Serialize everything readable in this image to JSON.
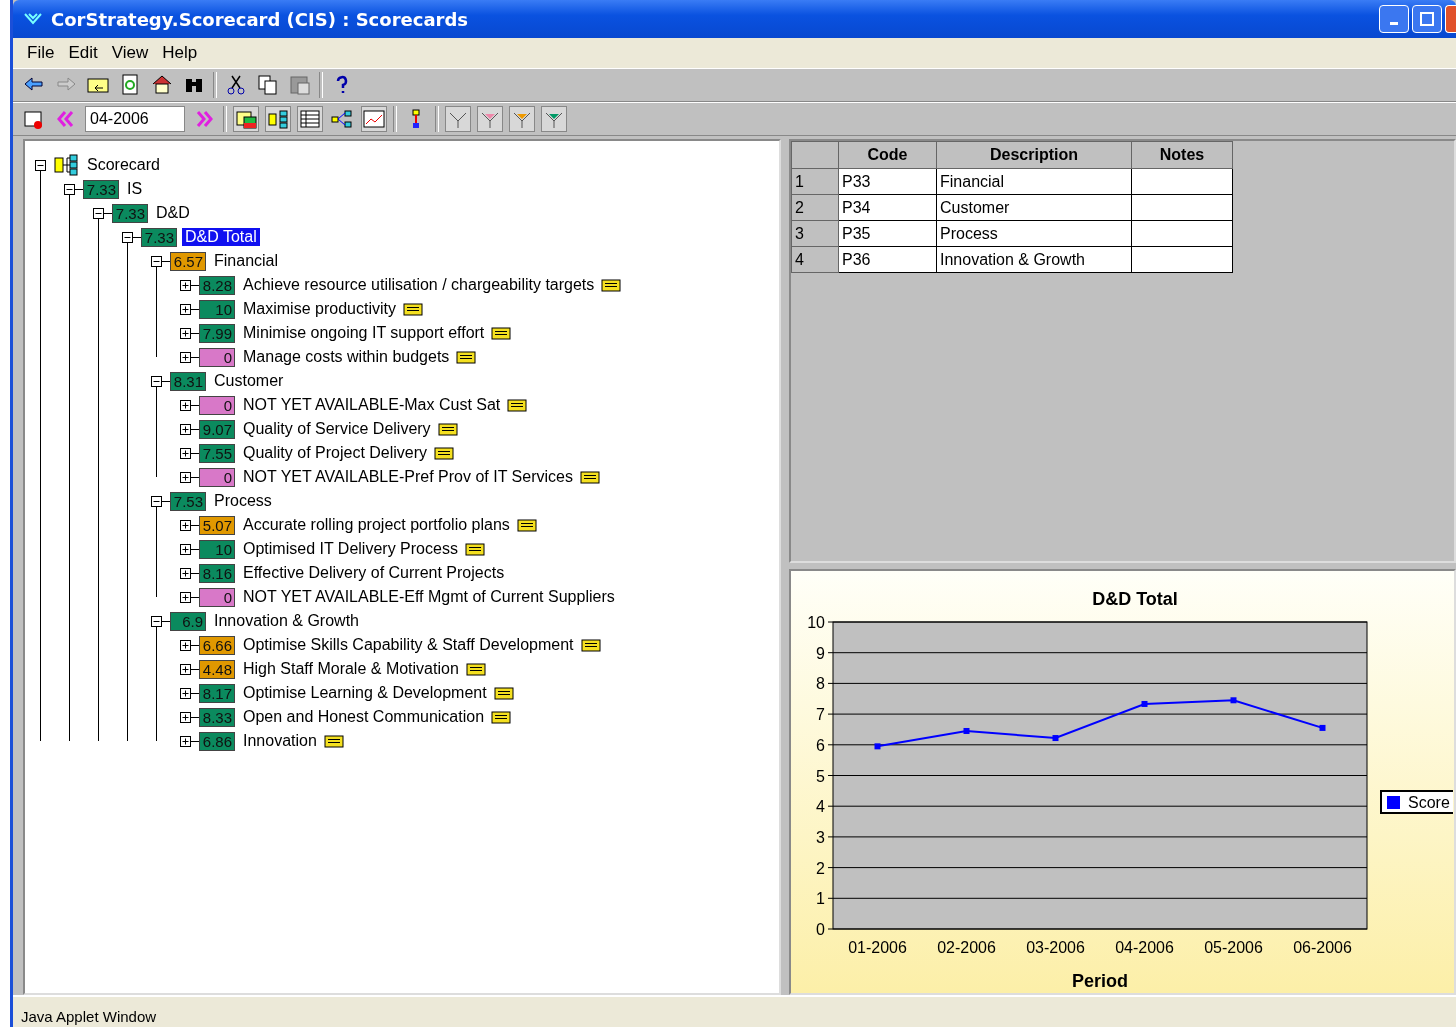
{
  "window": {
    "title": "CorStrategy.Scorecard (CIS) : Scorecards"
  },
  "menu": [
    "File",
    "Edit",
    "View",
    "Help"
  ],
  "period_field": {
    "value": "04-2006"
  },
  "tree": {
    "kind": "root",
    "label": "Scorecard",
    "expanded": true,
    "selected": false,
    "children": [
      {
        "label": "IS",
        "score": "7.33",
        "color": "#0b8a5e",
        "expanded": true,
        "selected": false,
        "note": false,
        "children": [
          {
            "label": "D&D",
            "score": "7.33",
            "color": "#0b8a5e",
            "expanded": true,
            "selected": false,
            "note": false,
            "children": [
              {
                "label": "D&D Total",
                "score": "7.33",
                "color": "#0b8a5e",
                "expanded": true,
                "selected": true,
                "note": false,
                "children": [
                  {
                    "label": "Financial",
                    "score": "6.57",
                    "color": "#e09800",
                    "expanded": true,
                    "selected": false,
                    "note": false,
                    "children": [
                      {
                        "label": "Achieve resource utilisation / chargeability targets",
                        "score": "8.28",
                        "color": "#0b8a5e",
                        "expanded": false,
                        "selected": false,
                        "note": true
                      },
                      {
                        "label": "Maximise productivity",
                        "score": "10",
                        "color": "#0b8a5e",
                        "expanded": false,
                        "selected": false,
                        "note": true
                      },
                      {
                        "label": "Minimise ongoing IT support effort",
                        "score": "7.99",
                        "color": "#0b8a5e",
                        "expanded": false,
                        "selected": false,
                        "note": true
                      },
                      {
                        "label": "Manage costs within budgets",
                        "score": "0",
                        "color": "#d878c8",
                        "expanded": false,
                        "selected": false,
                        "note": true
                      }
                    ]
                  },
                  {
                    "label": "Customer",
                    "score": "8.31",
                    "color": "#0b8a5e",
                    "expanded": true,
                    "selected": false,
                    "note": false,
                    "children": [
                      {
                        "label": "NOT YET AVAILABLE-Max Cust Sat",
                        "score": "0",
                        "color": "#d878c8",
                        "expanded": false,
                        "selected": false,
                        "note": true
                      },
                      {
                        "label": "Quality of Service Delivery",
                        "score": "9.07",
                        "color": "#0b8a5e",
                        "expanded": false,
                        "selected": false,
                        "note": true
                      },
                      {
                        "label": "Quality of Project Delivery",
                        "score": "7.55",
                        "color": "#0b8a5e",
                        "expanded": false,
                        "selected": false,
                        "note": true
                      },
                      {
                        "label": "NOT YET AVAILABLE-Pref Prov of IT Services",
                        "score": "0",
                        "color": "#d878c8",
                        "expanded": false,
                        "selected": false,
                        "note": true
                      }
                    ]
                  },
                  {
                    "label": "Process",
                    "score": "7.53",
                    "color": "#0b8a5e",
                    "expanded": true,
                    "selected": false,
                    "note": false,
                    "children": [
                      {
                        "label": "Accurate rolling project portfolio plans",
                        "score": "5.07",
                        "color": "#e09800",
                        "expanded": false,
                        "selected": false,
                        "note": true
                      },
                      {
                        "label": "Optimised IT Delivery Process",
                        "score": "10",
                        "color": "#0b8a5e",
                        "expanded": false,
                        "selected": false,
                        "note": true
                      },
                      {
                        "label": "Effective Delivery of Current Projects",
                        "score": "8.16",
                        "color": "#0b8a5e",
                        "expanded": false,
                        "selected": false,
                        "note": false
                      },
                      {
                        "label": "NOT YET AVAILABLE-Eff Mgmt of Current Suppliers",
                        "score": "0",
                        "color": "#d878c8",
                        "expanded": false,
                        "selected": false,
                        "note": false
                      }
                    ]
                  },
                  {
                    "label": "Innovation & Growth",
                    "score": "6.9",
                    "color": "#0b8a5e",
                    "expanded": true,
                    "selected": false,
                    "note": false,
                    "children": [
                      {
                        "label": "Optimise Skills Capability & Staff Development",
                        "score": "6.66",
                        "color": "#e09800",
                        "expanded": false,
                        "selected": false,
                        "note": true
                      },
                      {
                        "label": "High Staff Morale & Motivation",
                        "score": "4.48",
                        "color": "#e09800",
                        "expanded": false,
                        "selected": false,
                        "note": true
                      },
                      {
                        "label": "Optimise Learning & Development",
                        "score": "8.17",
                        "color": "#0b8a5e",
                        "expanded": false,
                        "selected": false,
                        "note": true
                      },
                      {
                        "label": "Open and Honest Communication",
                        "score": "8.33",
                        "color": "#0b8a5e",
                        "expanded": false,
                        "selected": false,
                        "note": true
                      },
                      {
                        "label": "Innovation",
                        "score": "6.86",
                        "color": "#0b8a5e",
                        "expanded": false,
                        "selected": false,
                        "note": true
                      }
                    ]
                  }
                ]
              }
            ]
          }
        ]
      }
    ]
  },
  "table": {
    "columns": [
      "Code",
      "Description",
      "Notes"
    ],
    "rows": [
      {
        "number": "1",
        "cells": [
          "P33",
          "Financial",
          ""
        ]
      },
      {
        "number": "2",
        "cells": [
          "P34",
          "Customer",
          ""
        ]
      },
      {
        "number": "3",
        "cells": [
          "P35",
          "Process",
          ""
        ]
      },
      {
        "number": "4",
        "cells": [
          "P36",
          "Innovation & Growth",
          ""
        ]
      }
    ]
  },
  "chart": {
    "chart_data": {
      "type": "line",
      "title": "D&D Total",
      "xlabel": "Period",
      "categories": [
        "01-2006",
        "02-2006",
        "03-2006",
        "04-2006",
        "05-2006",
        "06-2006"
      ],
      "series": [
        {
          "name": "Score",
          "color": "#0000ff",
          "marker": "square",
          "values": [
            5.95,
            6.45,
            6.22,
            7.33,
            7.45,
            6.55
          ]
        }
      ],
      "grid": true,
      "ylim": [
        0,
        10
      ],
      "yticks": [
        0,
        1,
        2,
        3,
        4,
        5,
        6,
        7,
        8,
        9,
        10
      ]
    }
  },
  "status_bar": "Java Applet Window"
}
